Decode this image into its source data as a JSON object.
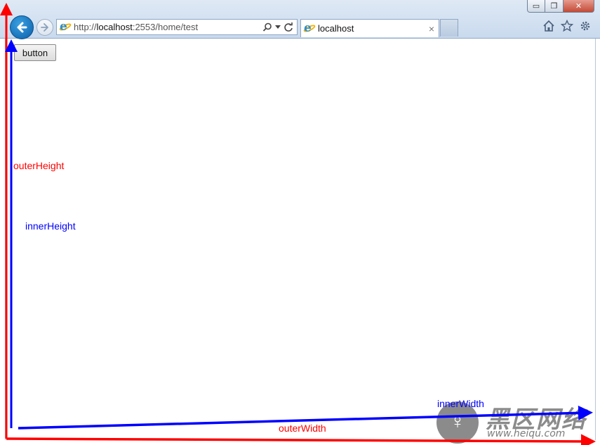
{
  "browser": {
    "url_prefix": "http://",
    "url_host": "localhost",
    "url_rest": ":2553/home/test",
    "tab_title": "localhost",
    "tab_close": "×",
    "caption": {
      "minimize": "▭",
      "restore": "❐",
      "close": "✕"
    },
    "icons": [
      "back-arrow-icon",
      "forward-arrow-icon",
      "search-icon",
      "dropdown-icon",
      "refresh-icon",
      "home-icon",
      "star-icon",
      "gear-icon"
    ]
  },
  "page": {
    "button_label": "button"
  },
  "annotations": {
    "outer_height": "outerHeight",
    "inner_height": "innerHeight",
    "inner_width": "innerWidth",
    "outer_width": "outerWidth",
    "outer_color": "#ff0000",
    "inner_color": "#0000ff"
  },
  "watermark": {
    "title": "黑区网络",
    "url": "www.heiqu.com"
  }
}
